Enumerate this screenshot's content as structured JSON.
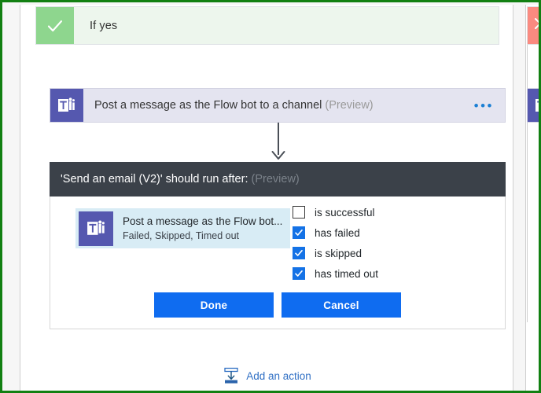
{
  "scope": {
    "status_icon": "checkmark-icon",
    "title": "If yes"
  },
  "action_card": {
    "icon": "microsoft-teams-icon",
    "label": "Post a message as the Flow bot to a channel",
    "preview_tag": "(Preview)",
    "menu_icon": "ellipsis-icon"
  },
  "connector": {
    "icon": "down-arrow-icon"
  },
  "run_after": {
    "title": "'Send an email (V2)' should run after:",
    "preview_tag": "(Preview)",
    "dependency": {
      "icon": "microsoft-teams-icon",
      "title": "Post a message as the Flow bot...",
      "statuses_summary": "Failed, Skipped, Timed out"
    },
    "status_options": [
      {
        "label": "is successful",
        "checked": false
      },
      {
        "label": "has failed",
        "checked": true
      },
      {
        "label": "is skipped",
        "checked": true
      },
      {
        "label": "has timed out",
        "checked": true
      }
    ],
    "done_label": "Done",
    "cancel_label": "Cancel"
  },
  "footer": {
    "add_action_icon": "insert-below-icon",
    "add_action_label": "Add an action"
  },
  "right_panel": {
    "status_icon": "cross-icon",
    "card_icon": "microsoft-teams-icon"
  },
  "colors": {
    "capture_border": "#128012",
    "scope_header_bg": "#edf6ed",
    "scope_status_bg": "#8ed68e",
    "teams_purple": "#5558af",
    "action_card_bg": "#e4e4f0",
    "runafter_bar_bg": "#3b4149",
    "dependency_bg": "#d8ecf5",
    "checkbox_checked": "#1472e6",
    "button_blue": "#0f6cf0",
    "link_blue": "#2f6fc4",
    "right_status_bg": "#fa8a80"
  }
}
